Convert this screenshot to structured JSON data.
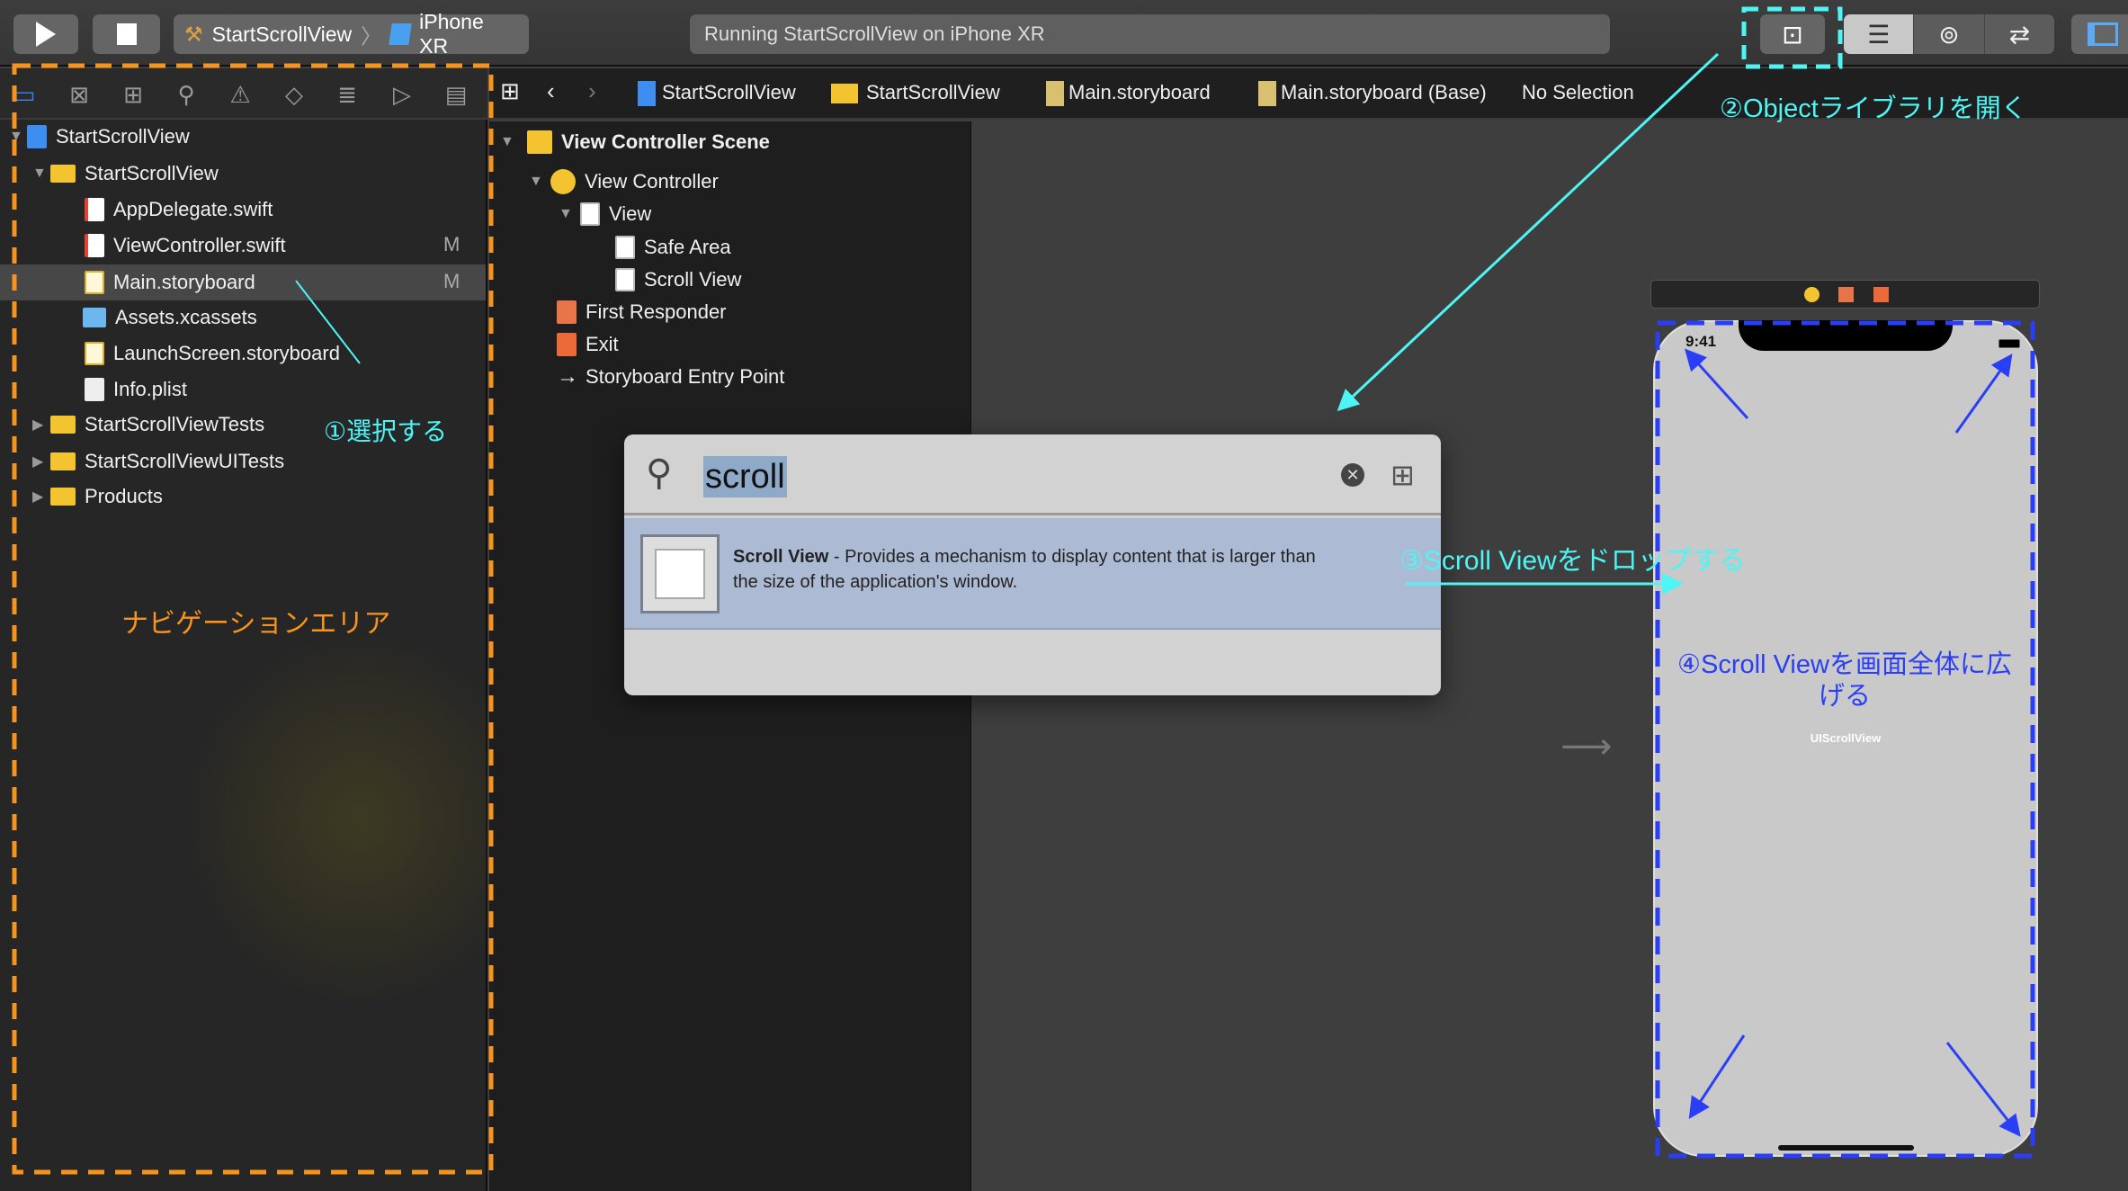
{
  "colors": {
    "annotation_orange": "#f7941d",
    "annotation_cyan": "#4ff5f5",
    "annotation_blue": "#2a3ff5",
    "selection": "#8fa9c9"
  },
  "toolbar": {
    "run_icon": "play-icon",
    "stop_icon": "stop-icon",
    "scheme": "StartScrollView",
    "device": "iPhone XR",
    "status": "Running StartScrollView on iPhone XR",
    "library_icon": "object-library-icon",
    "editor_icons": [
      "standard-editor-icon",
      "assistant-editor-icon",
      "version-editor-icon"
    ],
    "panel_icon": "navigator-toggle-icon"
  },
  "navigator": {
    "tabs": [
      "folder-icon",
      "source-control-icon",
      "hierarchy-icon",
      "search-icon",
      "warning-icon",
      "test-icon",
      "debug-icon",
      "breakpoint-icon",
      "report-icon"
    ],
    "items": [
      {
        "label": "StartScrollView",
        "type": "project",
        "expanded": true
      },
      {
        "label": "StartScrollView",
        "type": "folder",
        "expanded": true
      },
      {
        "label": "AppDelegate.swift",
        "type": "swift"
      },
      {
        "label": "ViewController.swift",
        "type": "swift",
        "badge": "M"
      },
      {
        "label": "Main.storyboard",
        "type": "storyboard",
        "badge": "M",
        "selected": true
      },
      {
        "label": "Assets.xcassets",
        "type": "assets"
      },
      {
        "label": "LaunchScreen.storyboard",
        "type": "storyboard"
      },
      {
        "label": "Info.plist",
        "type": "plist"
      },
      {
        "label": "StartScrollViewTests",
        "type": "folder",
        "expanded": false
      },
      {
        "label": "StartScrollViewUITests",
        "type": "folder",
        "expanded": false
      },
      {
        "label": "Products",
        "type": "folder",
        "expanded": false
      }
    ]
  },
  "jumpbar": {
    "crumbs": [
      "StartScrollView",
      "StartScrollView",
      "Main.storyboard",
      "Main.storyboard (Base)",
      "No Selection"
    ]
  },
  "outline": {
    "items": [
      "View Controller Scene",
      "View Controller",
      "View",
      "Safe Area",
      "Scroll View",
      "First Responder",
      "Exit",
      "Storyboard Entry Point"
    ]
  },
  "library": {
    "search_value": "scroll",
    "result_title": "Scroll View",
    "result_desc_line1": " - Provides a mechanism to display content that is larger than",
    "result_desc_line2": "the size of the application's window."
  },
  "canvas": {
    "time": "9:41",
    "scroll_label": "UIScrollView"
  },
  "annotations": {
    "nav_area": "ナビゲーションエリア",
    "step1": "①選択する",
    "step2": "②Objectライブラリを開く",
    "step3": "③Scroll Viewをドロップする",
    "step4_line1": "④Scroll Viewを画面全体に広",
    "step4_line2": "げる"
  }
}
